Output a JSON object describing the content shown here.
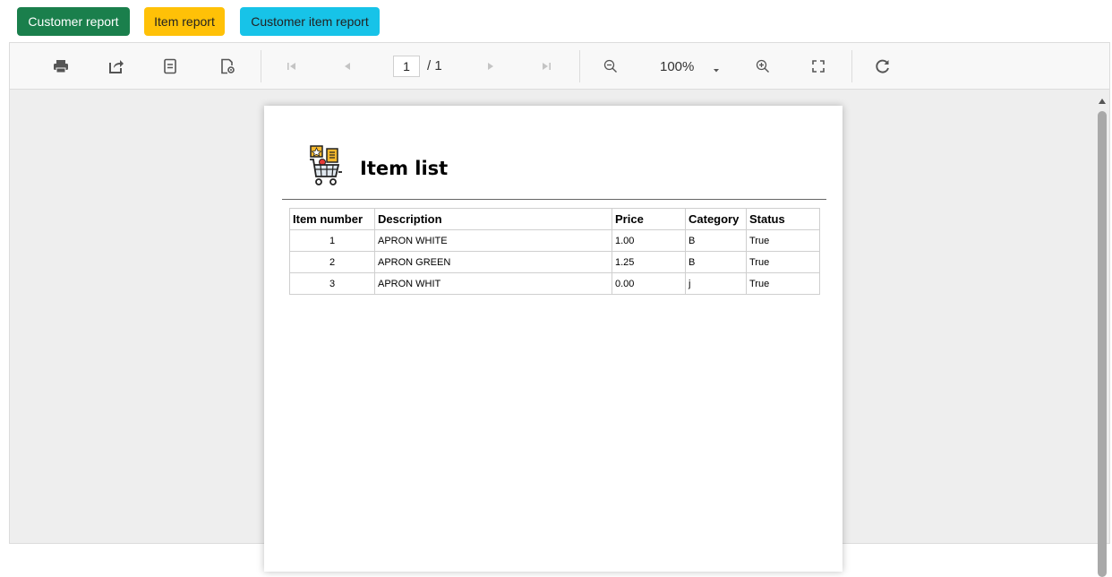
{
  "reports": {
    "customer": {
      "label": "Customer report",
      "color": "#1a7f4c",
      "text_color": "#ffffff"
    },
    "item": {
      "label": "Item report",
      "color": "#ffc107",
      "text_color": "#222222"
    },
    "customer_item": {
      "label": "Customer item report",
      "color": "#17c3e8",
      "text_color": "#222222"
    }
  },
  "toolbar": {
    "icons": [
      "print-icon",
      "export-icon",
      "page-setup-icon",
      "parameters-icon",
      "first-page-icon",
      "previous-page-icon",
      "next-page-icon",
      "last-page-icon",
      "zoom-out-icon",
      "zoom-in-icon",
      "fit-page-icon",
      "refresh-icon"
    ],
    "current_page": "1",
    "page_total": "/ 1",
    "zoom": "100%"
  },
  "report": {
    "title": "Item list",
    "logo_icon": "shopping-cart-icon",
    "columns": [
      "Item number",
      "Description",
      "Price",
      "Category",
      "Status"
    ],
    "rows": [
      {
        "number": "1",
        "description": "APRON WHITE",
        "price": "1.00",
        "category": "B",
        "status": "True"
      },
      {
        "number": "2",
        "description": "APRON GREEN",
        "price": "1.25",
        "category": "B",
        "status": "True"
      },
      {
        "number": "3",
        "description": "APRON WHIT",
        "price": "0.00",
        "category": "j",
        "status": "True"
      }
    ]
  }
}
